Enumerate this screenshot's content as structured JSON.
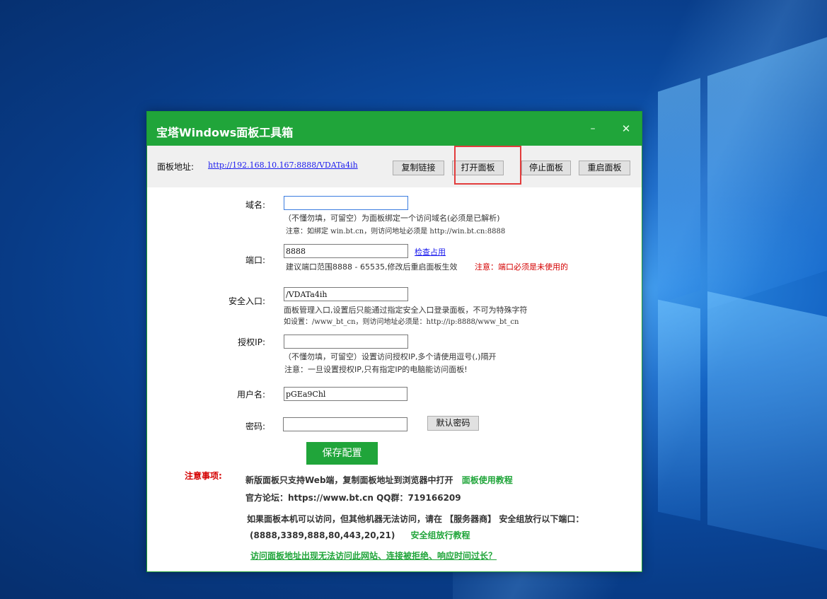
{
  "window": {
    "title": "宝塔Windows面板工具箱",
    "minimize_glyph": "–",
    "close_glyph": "✕"
  },
  "address": {
    "label": "面板地址:",
    "url": "http://192.168.10.167:8888/VDATa4ih",
    "buttons": {
      "copy": "复制链接",
      "open": "打开面板",
      "stop": "停止面板",
      "restart": "重启面板"
    },
    "highlight_color": "#e23c3c"
  },
  "form": {
    "domain": {
      "label": "域名:",
      "value": "",
      "hint1": "（不懂勿填，可留空）为面板绑定一个访问域名(必须是已解析)",
      "hint2": "注意：如绑定 win.bt.cn，则访问地址必须是 http://win.bt.cn:8888"
    },
    "port": {
      "label": "端口:",
      "value": "8888",
      "check_link": "检查占用",
      "hint": "建议端口范围8888 - 65535,修改后重启面板生效",
      "warning": "注意：端口必须是未使用的"
    },
    "entry": {
      "label": "安全入口:",
      "value": "/VDATa4ih",
      "hint1": "面板管理入口,设置后只能通过指定安全入口登录面板，不可为特殊字符",
      "hint2": "如设置：/www_bt_cn，则访问地址必须是：http://ip:8888/www_bt_cn"
    },
    "auth_ip": {
      "label": "授权IP:",
      "value": "",
      "hint1": "（不懂勿填，可留空）设置访问授权IP,多个请使用逗号(,)隔开",
      "hint2": "注意：一旦设置授权IP,只有指定IP的电脑能访问面板!"
    },
    "username": {
      "label": "用户名:",
      "value": "pGEa9Chl"
    },
    "password": {
      "label": "密码:",
      "value": "",
      "default_button": "默认密码"
    },
    "save_button": "保存配置"
  },
  "notice": {
    "title": "注意事项:",
    "line1": "新版面板只支持Web端，复制面板地址到浏览器中打开",
    "tutorial_link": "面板使用教程",
    "line2": "官方论坛：https://www.bt.cn   QQ群：719166209",
    "line3": "如果面板本机可以访问，但其他机器无法访问，请在 【服务器商】 安全组放行以下端口：",
    "ports": "(8888,3389,888,80,443,20,21)",
    "security_link": "安全组放行教程",
    "bottom_link": "访问面板地址出现无法访问此网站、连接被拒绝、响应时间过长？"
  },
  "colors": {
    "brand_green": "#20a53a",
    "warning_red": "#d40000",
    "link_blue": "#1a1aee"
  }
}
